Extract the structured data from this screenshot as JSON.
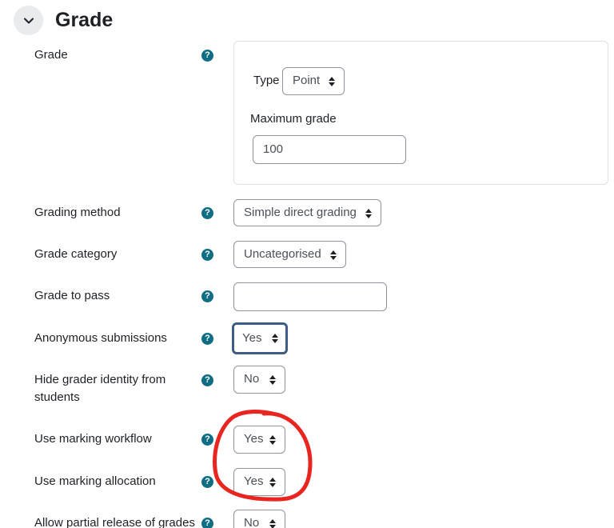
{
  "section": {
    "title": "Grade",
    "toggle_icon": "chevron-down-icon"
  },
  "help_icon": "question-circle-icon",
  "colors": {
    "help_icon": "#0f6e84",
    "focus_border": "#3f5d83",
    "annotation": "#e8251f",
    "field_border": "#8f959e"
  },
  "grade": {
    "label": "Grade",
    "type_label": "Type",
    "type_value": "Point",
    "max_label": "Maximum grade",
    "max_value": "100"
  },
  "fields": {
    "grading_method": {
      "label": "Grading method",
      "value": "Simple direct grading"
    },
    "grade_category": {
      "label": "Grade category",
      "value": "Uncategorised"
    },
    "grade_to_pass": {
      "label": "Grade to pass",
      "value": ""
    },
    "anonymous": {
      "label": "Anonymous submissions",
      "value": "Yes"
    },
    "hide_grader": {
      "label_line1": "Hide grader identity from",
      "label_line2": "students",
      "value": "No"
    },
    "marking_workflow": {
      "label": "Use marking workflow",
      "value": "Yes"
    },
    "marking_allocation": {
      "label": "Use marking allocation",
      "value": "Yes"
    },
    "partial_release": {
      "label": "Allow partial release of grades",
      "value": "No"
    }
  }
}
